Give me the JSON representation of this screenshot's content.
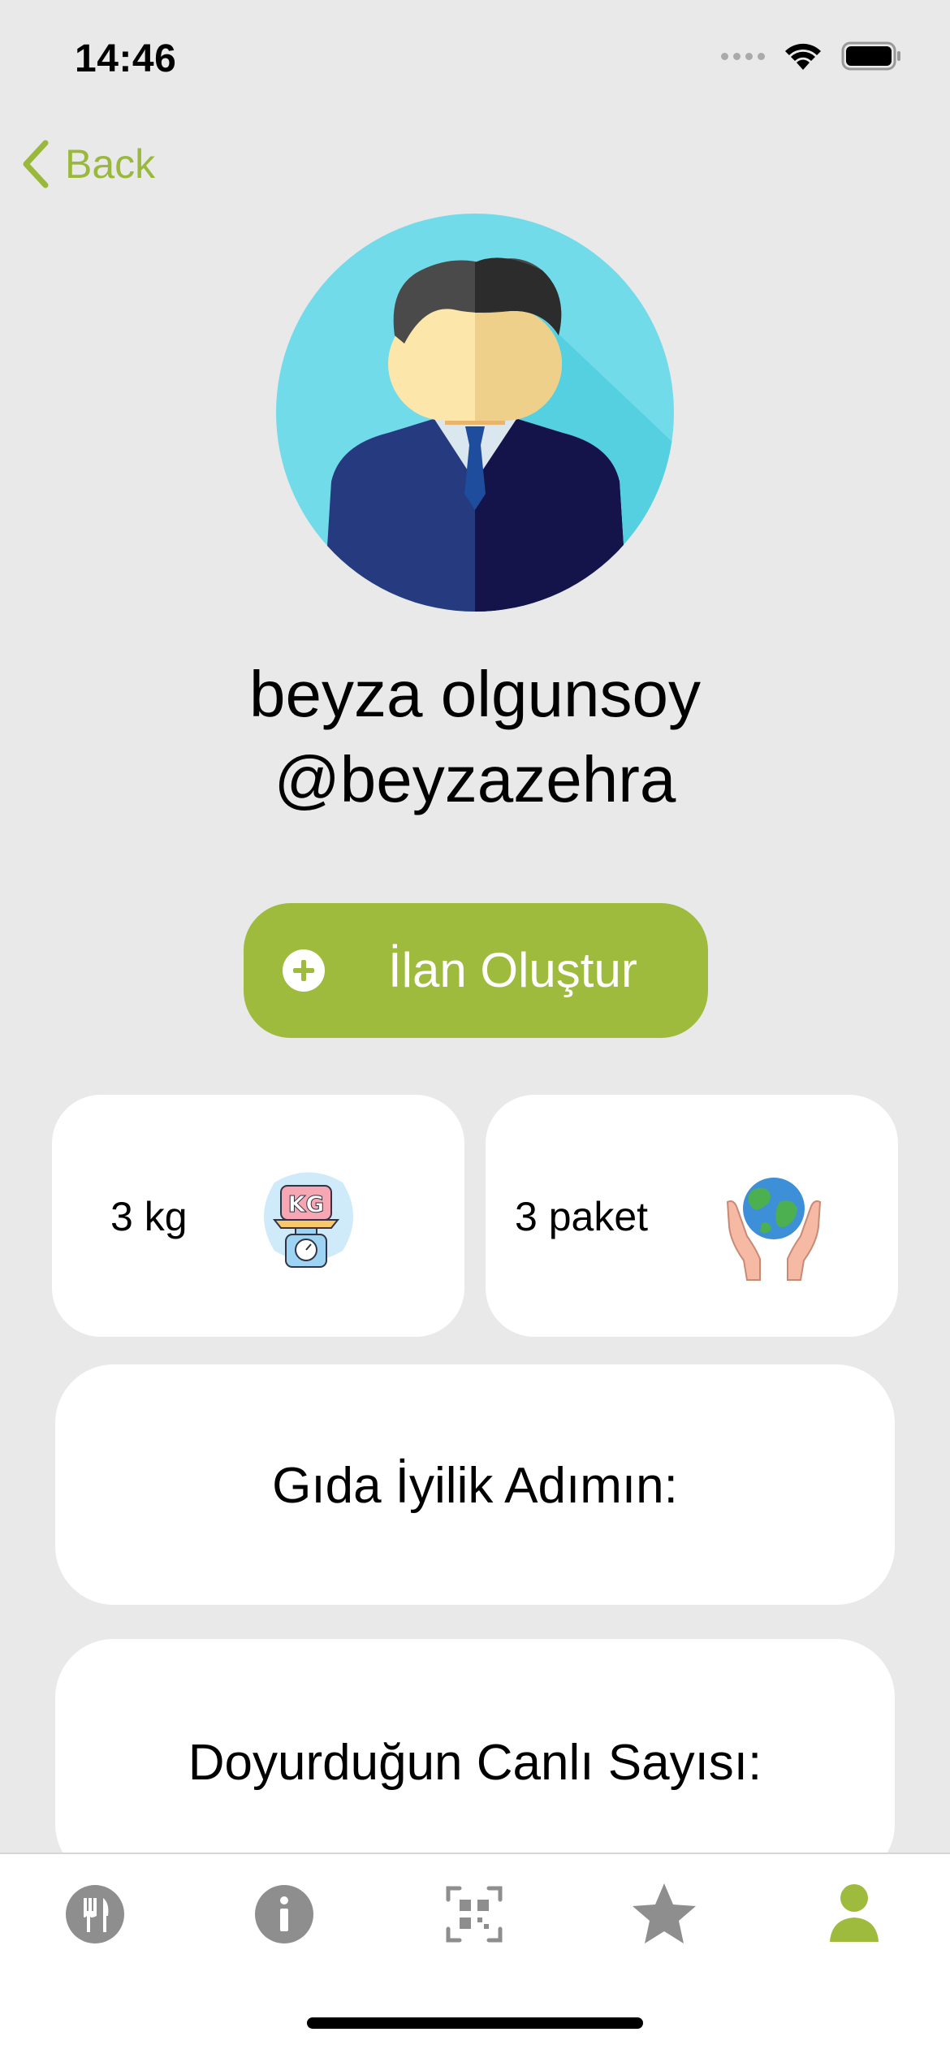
{
  "status_bar": {
    "time": "14:46"
  },
  "nav": {
    "back_label": "Back"
  },
  "profile": {
    "full_name": "beyza olgunsoy",
    "username": "@beyzazehra"
  },
  "actions": {
    "create_listing_label": "İlan Oluştur"
  },
  "stats": [
    {
      "value": "3 kg",
      "icon": "kg-scale-icon"
    },
    {
      "value": "3 paket",
      "icon": "earth-in-hands-icon"
    }
  ],
  "info_cards": [
    {
      "label": "Gıda İyilik Adımın:"
    },
    {
      "label": "Doyurduğun Canlı Sayısı:"
    }
  ],
  "tab_bar": {
    "items": [
      {
        "icon": "fork-knife-icon",
        "active": false
      },
      {
        "icon": "info-icon",
        "active": false
      },
      {
        "icon": "qr-scan-icon",
        "active": false
      },
      {
        "icon": "star-icon",
        "active": false
      },
      {
        "icon": "person-icon",
        "active": true
      }
    ]
  },
  "colors": {
    "accent": "#9fbb3e",
    "background": "#e9e9e9",
    "inactive_icon": "#8e8e8e"
  }
}
